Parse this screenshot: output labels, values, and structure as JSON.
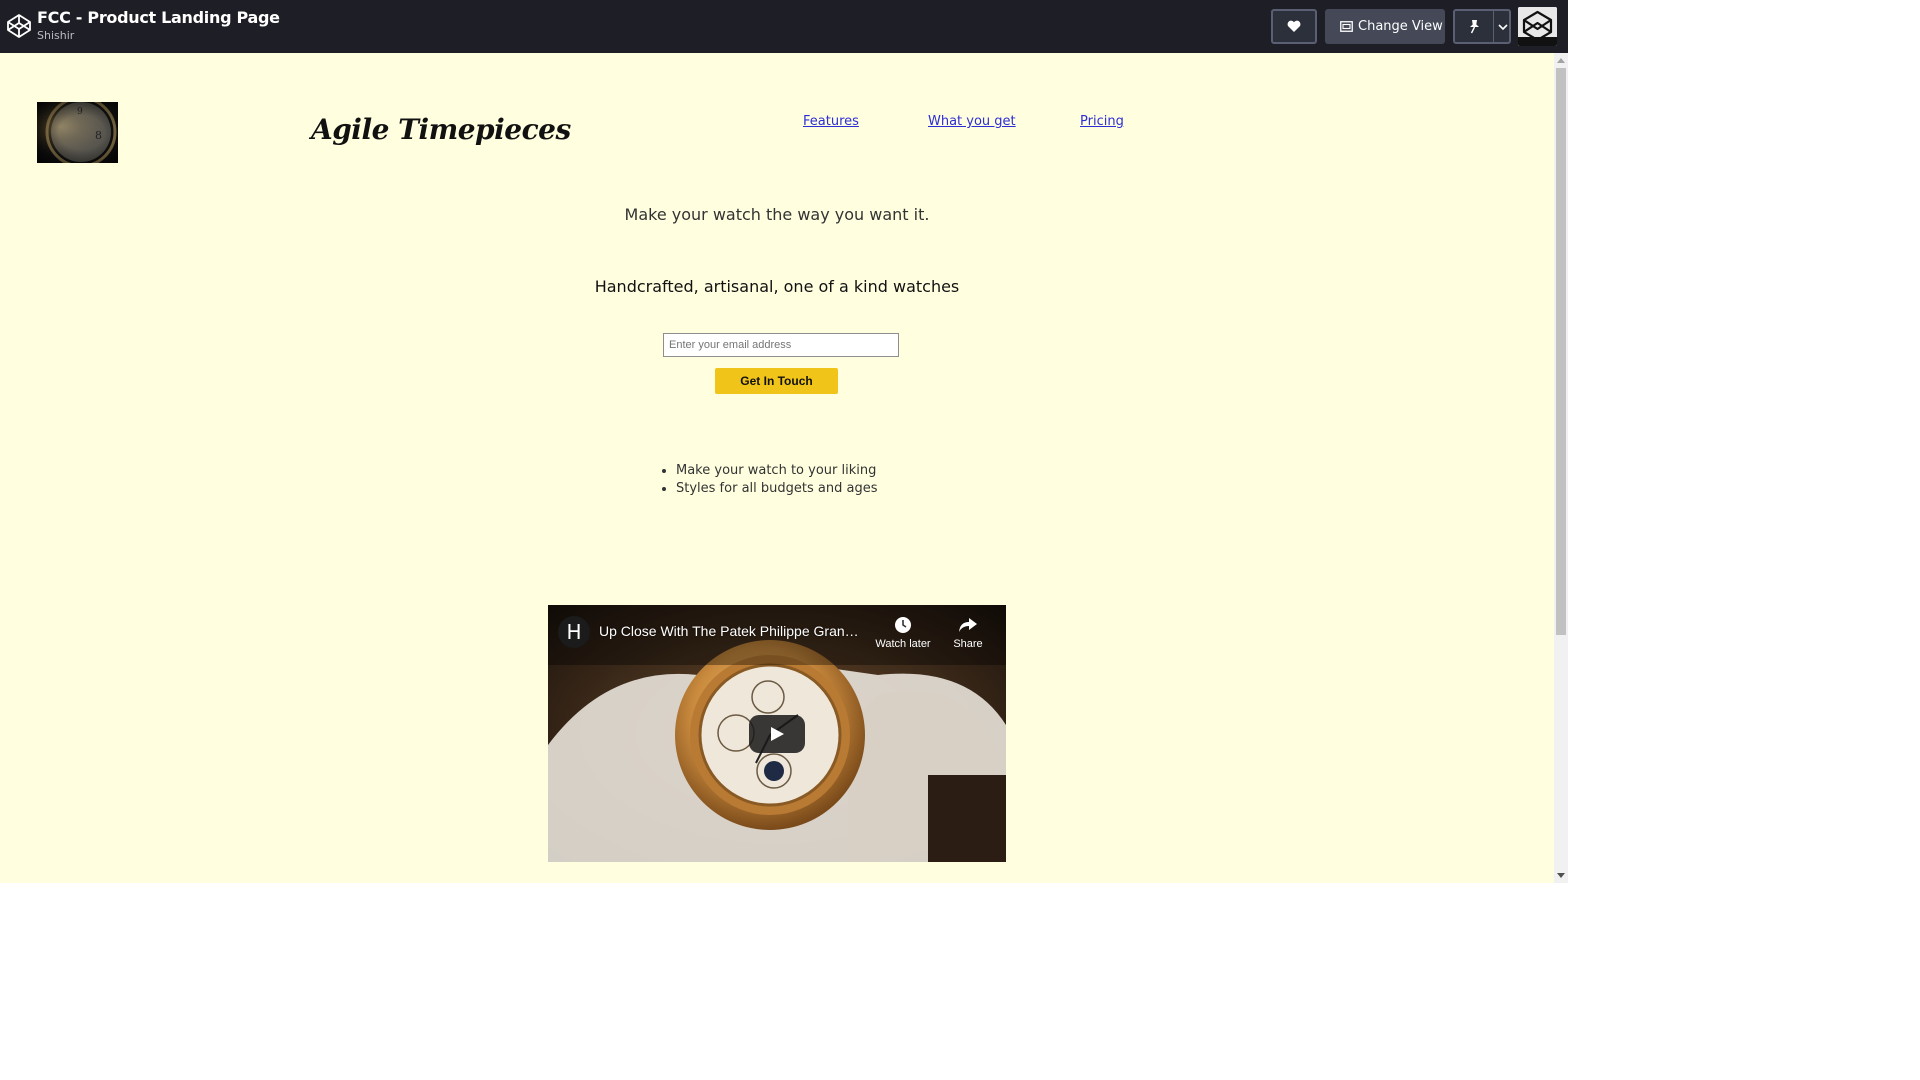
{
  "topbar": {
    "title": "FCC - Product Landing Page",
    "author": "Shishir",
    "change_view_label": "Change View"
  },
  "page": {
    "brand": "Agile Timepieces",
    "nav": [
      {
        "label": "Features"
      },
      {
        "label": "What you get"
      },
      {
        "label": "Pricing"
      }
    ],
    "tagline": "Make your watch the way you want it.",
    "subhead": "Handcrafted, artisanal, one of a kind watches",
    "email_placeholder": "Enter your email address",
    "cta_label": "Get In Touch",
    "features": [
      "Make your watch to your liking",
      "Styles for all budgets and ages"
    ]
  },
  "video": {
    "channel_initial": "H",
    "title": "Up Close With The Patek Philippe Grandmaster Chime",
    "watch_later": "Watch later",
    "share": "Share"
  },
  "colors": {
    "page_bg": "#ffffe0",
    "topbar_bg": "#1e1f26",
    "cta_bg": "#f0c419",
    "link": "#2d2dd6"
  },
  "icons": [
    "codepen-logo-icon",
    "heart-icon",
    "change-view-icon",
    "pin-icon",
    "chevron-down-icon",
    "clock-icon",
    "share-icon",
    "play-icon"
  ]
}
